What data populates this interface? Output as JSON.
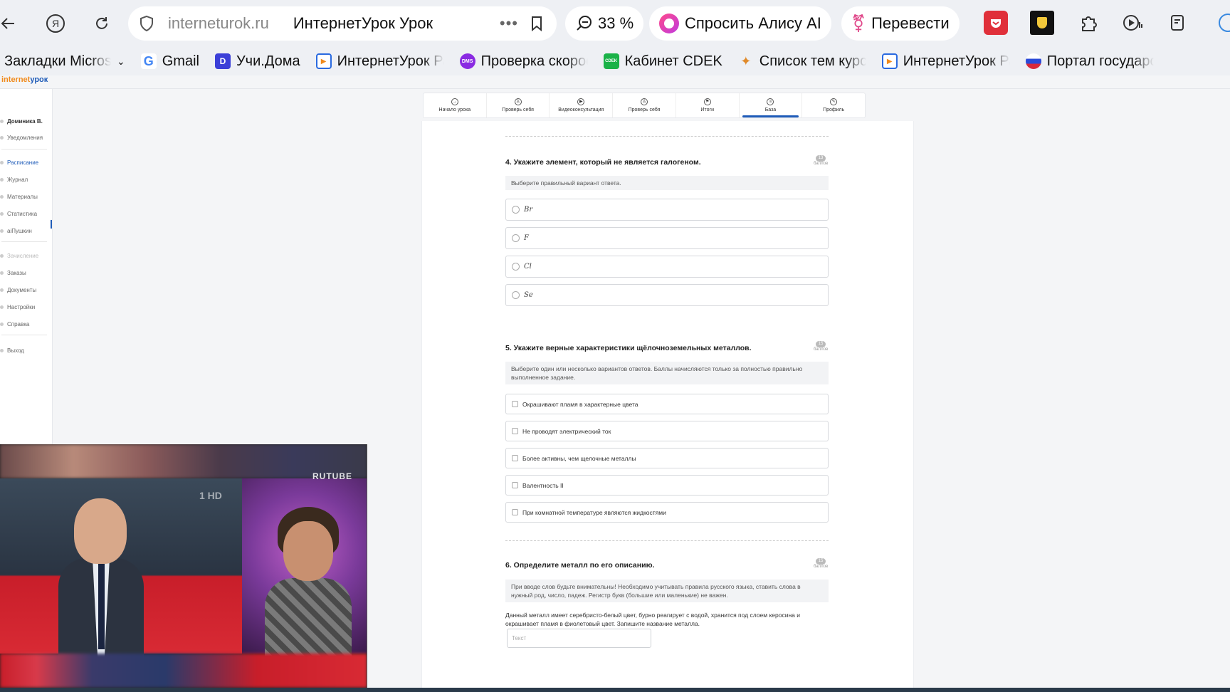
{
  "browser": {
    "back_icon": "arrow-left-icon",
    "yandex_icon": "yandex-icon",
    "reload_icon": "reload-icon",
    "domain": "internet​urok.ru",
    "page_title": "ИнтернетУрок Урок",
    "more": "•••",
    "zoom_label": "33 %",
    "alice_label": "Спросить Алису AI",
    "translate_label": "Перевести"
  },
  "bookmarks": [
    {
      "label": "Закладки Microsoft E",
      "color": "#ffffff",
      "icon": ""
    },
    {
      "label": "Gmail",
      "color": "#ffffff",
      "icon": "G"
    },
    {
      "label": "Учи.Дома",
      "color": "#3b3fd8",
      "icon": "D"
    },
    {
      "label": "ИнтернетУрок Ра",
      "color": "#2a6ae0",
      "icon": "▶"
    },
    {
      "label": "Проверка скорос",
      "color": "#8a2be2",
      "icon": "DMS"
    },
    {
      "label": "Кабинет CDEK",
      "color": "#1ab248",
      "icon": "CDEK"
    },
    {
      "label": "Список тем курса",
      "color": "#e08a2a",
      "icon": "✦"
    },
    {
      "label": "ИнтернетУрок Ра",
      "color": "#2a6ae0",
      "icon": "▶"
    },
    {
      "label": "Портал государст",
      "color": "#d8283a",
      "icon": "●"
    }
  ],
  "logo": {
    "part1": "internet",
    "part2": "урок"
  },
  "sidebar": {
    "user": "Доминика В.",
    "notifications": "Уведомления",
    "items": [
      "Расписание",
      "Журнал",
      "Материалы",
      "Статистика",
      "аіПушкин"
    ],
    "section2_title": "Зачисление",
    "items2": [
      "Заказы",
      "Документы",
      "Настройки",
      "Справка"
    ],
    "logout": "Выход"
  },
  "tabs": [
    {
      "label": "Начало урока",
      "icon": "→"
    },
    {
      "label": "Проверь себя",
      "icon": "♙"
    },
    {
      "label": "Видеоконсультация",
      "icon": "▶"
    },
    {
      "label": "Проверь себя",
      "icon": "♙"
    },
    {
      "label": "Итоги",
      "icon": "⚑"
    },
    {
      "label": "База",
      "icon": "≡"
    },
    {
      "label": "Профиль",
      "icon": "✎"
    }
  ],
  "q4": {
    "title": "4. Укажите элемент, который не является галогеном.",
    "points": "13",
    "points_label": "баллов",
    "hint": "Выберите правильный вариант ответа.",
    "options": [
      "Br",
      "F",
      "Cl",
      "Se"
    ]
  },
  "q5": {
    "title": "5. Укажите верные характеристики щёлочноземельных металлов.",
    "points": "15",
    "points_label": "баллов",
    "hint": "Выберите один или несколько вариантов ответов. Баллы начисляются только за полностью правильно выполненное задание.",
    "options": [
      "Окрашивают пламя в характерные цвета",
      "Не проводят электрический ток",
      "Более активны, чем щелочные металлы",
      "Валентность II",
      "При комнатной температуре являются жидкостями"
    ]
  },
  "q6": {
    "title": "6. Определите металл по его описанию.",
    "points": "15",
    "points_label": "баллов",
    "hint": "При вводе слов будьте внимательны! Необходимо учитывать правила русского языка, ставить слова в нужный род, число, падеж. Регистр букв (большие или маленькие) не важен.",
    "description": "Данный металл имеет серебристо-белый цвет, бурно реагирует с водой, хранится под слоем керосина и окрашивает пламя в фиолетовый цвет. Запишите название металла.",
    "input_placeholder": "Текст"
  },
  "video": {
    "watermark": "RUTUBE",
    "channel": "1 HD"
  }
}
